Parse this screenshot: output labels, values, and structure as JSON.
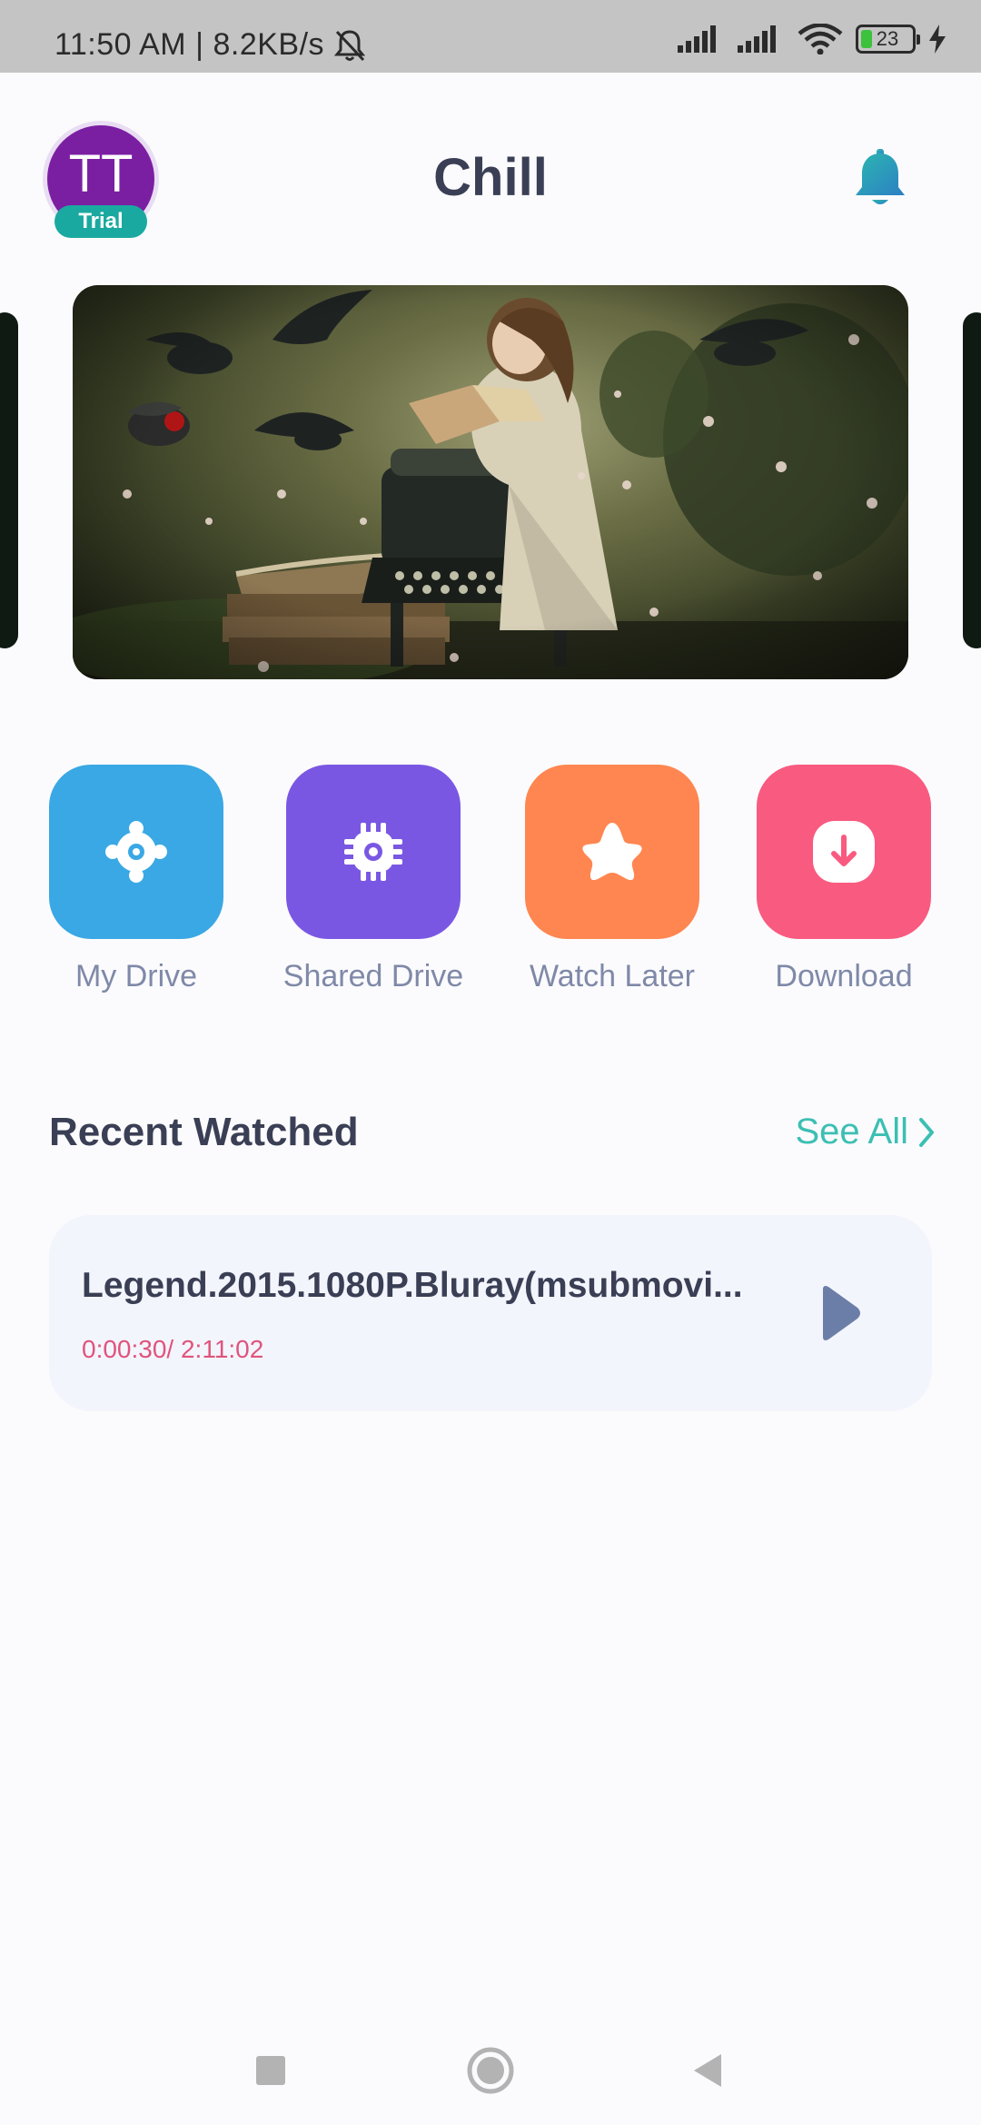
{
  "status_bar": {
    "time": "11:50 AM",
    "separator": "|",
    "network_speed": "8.2KB/s",
    "battery_level": "23",
    "battery_fraction": 0.23,
    "icons": [
      "bell-off-icon",
      "signal-icon",
      "signal-icon",
      "wifi-icon",
      "battery-icon",
      "charging-icon"
    ]
  },
  "header": {
    "title": "Chill",
    "avatar_initials": "TT",
    "badge": "Trial",
    "notification_icon": "bell-icon"
  },
  "carousel": {
    "banner_description_icon": "artwork-banner"
  },
  "quick_actions": [
    {
      "label": "My Drive",
      "icon": "drive-icon",
      "color": "#3aa8e4"
    },
    {
      "label": "Shared Drive",
      "icon": "chip-icon",
      "color": "#7a57e3"
    },
    {
      "label": "Watch Later",
      "icon": "star-icon",
      "color": "#ff8650"
    },
    {
      "label": "Download",
      "icon": "download-icon",
      "color": "#f95a7f"
    }
  ],
  "recent": {
    "section_title": "Recent Watched",
    "see_all": "See All",
    "items": [
      {
        "title": "Legend.2015.1080P.Bluray(msubmovi...",
        "progress": "0:00:30/ 2:11:02"
      }
    ]
  },
  "colors": {
    "accent": "#3cbfb3",
    "title_text": "#3a3f55",
    "progress_text": "#e0547c",
    "avatar": "#7b1fa2",
    "badge": "#1aa9a0"
  },
  "nav": {
    "icons": [
      "recents-icon",
      "home-icon",
      "back-icon"
    ]
  }
}
